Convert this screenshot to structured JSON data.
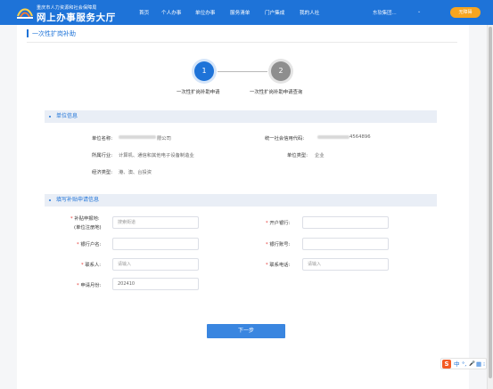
{
  "header": {
    "org": "重庆市人力资源和社会保障局",
    "site_title": "网上办事服务大厅",
    "nav": [
      "首页",
      "个人办事",
      "单位办事",
      "服务清单",
      "门户集成",
      "我的人社"
    ],
    "user": "东软集团...",
    "exit_label": "无障碍"
  },
  "page": {
    "title": "一次性扩岗补助"
  },
  "steps": [
    {
      "number": "1",
      "label": "一次性扩岗补助申请",
      "state": "active"
    },
    {
      "number": "2",
      "label": "一次性扩岗补助申请查询",
      "state": "inactive"
    }
  ],
  "unit_info": {
    "heading": "单位信息",
    "name_label": "单位名称:",
    "name_suffix": "限公司",
    "credit_code_label": "统一社会信用代码:",
    "credit_code_suffix": "4564896",
    "industry_label": "所属行业:",
    "industry_value": "计算机、通信和其他电子设备制造业",
    "unit_type_label": "单位类型:",
    "unit_type_value": "企业",
    "econ_type_label": "经济类型:",
    "econ_type_value": "港、澳、台投资"
  },
  "form": {
    "heading": "填写补贴申请信息",
    "subsidy_label": "补贴申报地:",
    "subsidy_sub": "(单位注册地)",
    "subsidy_placeholder": "搜索街道",
    "bank_label": "开户银行:",
    "account_name_label": "银行户名:",
    "account_no_label": "银行账号:",
    "contact_label": "联系人:",
    "contact_placeholder": "请输入",
    "phone_label": "联系电话:",
    "phone_placeholder": "请输入",
    "month_label": "申请月份:",
    "month_value": "202410",
    "required_mark": "*"
  },
  "actions": {
    "next_label": "下一步"
  },
  "ime": {
    "logo": "S",
    "items": [
      "中",
      "°,",
      "🎤",
      "▦",
      "⁝"
    ]
  },
  "colors": {
    "primary": "#1e73d8",
    "accent": "#f7a51f",
    "required": "#e53935"
  }
}
